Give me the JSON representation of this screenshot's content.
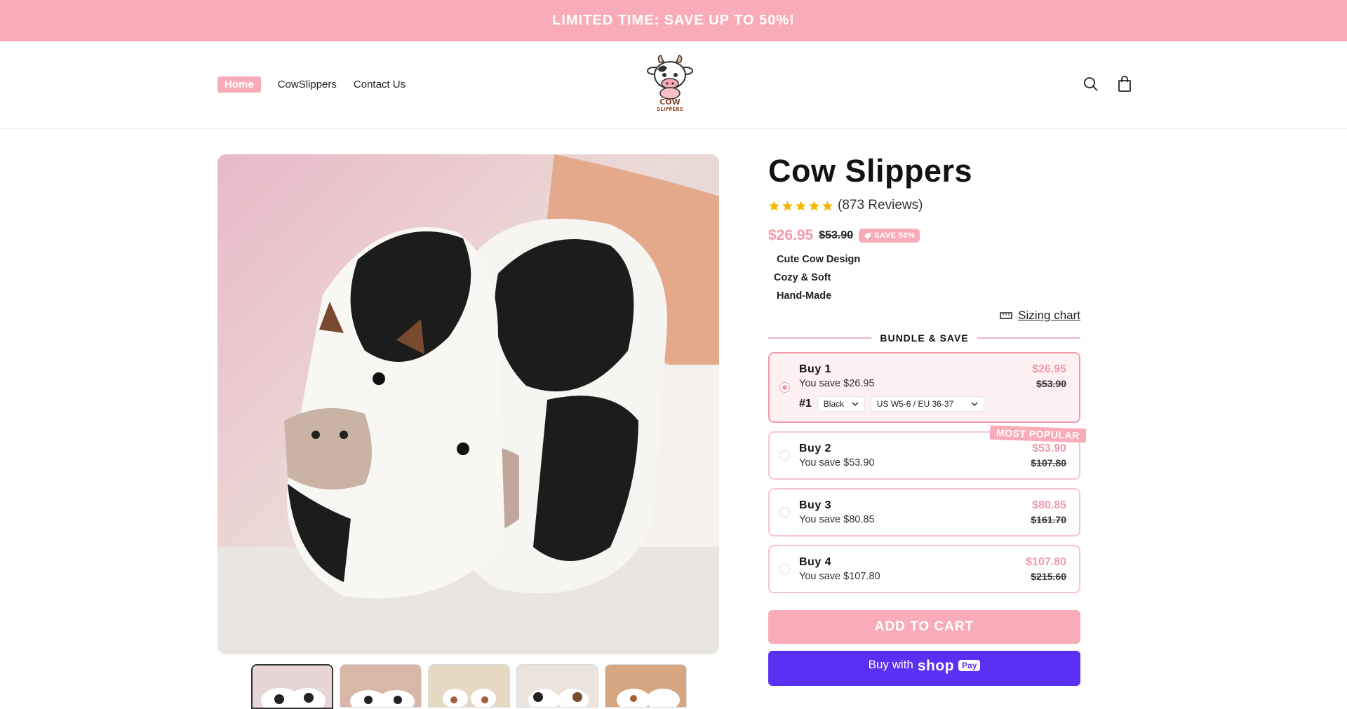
{
  "announcement": "LIMITED TIME: SAVE UP TO 50%!",
  "nav": {
    "home": "Home",
    "cowslippers": "CowSlippers",
    "contact": "Contact Us"
  },
  "logo": {
    "text_top": "COW",
    "text_bottom": "SLIPPERS"
  },
  "header_icons": [
    "search-icon",
    "cart-icon"
  ],
  "product": {
    "title": "Cow Slippers",
    "rating_stars": 5,
    "reviews": "(873 Reviews)",
    "price": "$26.95",
    "compare_price": "$53.90",
    "save_badge": "SAVE 50%",
    "features": [
      "Cute Cow Design",
      "Cozy & Soft",
      "Hand-Made"
    ],
    "sizing_chart": "Sizing chart"
  },
  "bundle": {
    "heading": "BUNDLE & SAVE",
    "selected_index": 0,
    "offers": [
      {
        "title": "Buy 1",
        "save": "You save $26.95",
        "price": "$26.95",
        "compare": "$53.90"
      },
      {
        "title": "Buy 2",
        "save": "You save $53.90",
        "price": "$53.90",
        "compare": "$107.80",
        "badge": "MOST POPULAR"
      },
      {
        "title": "Buy 3",
        "save": "You save $80.85",
        "price": "$80.85",
        "compare": "$161.70"
      },
      {
        "title": "Buy 4",
        "save": "You save $107.80",
        "price": "$107.80",
        "compare": "$215.60"
      }
    ],
    "variant": {
      "number": "#1",
      "color": "Black",
      "size": "US W5-6 / EU 36-37"
    }
  },
  "buttons": {
    "add_to_cart": "ADD TO CART",
    "shop_pay_prefix": "Buy with",
    "shop_pay_brand": "shop",
    "shop_pay_badge": "Pay"
  },
  "colors": {
    "accent": "#f9acb7",
    "accent_text": "#f29aa8",
    "shop_pay": "#5a31f4",
    "star": "#f5b800"
  }
}
